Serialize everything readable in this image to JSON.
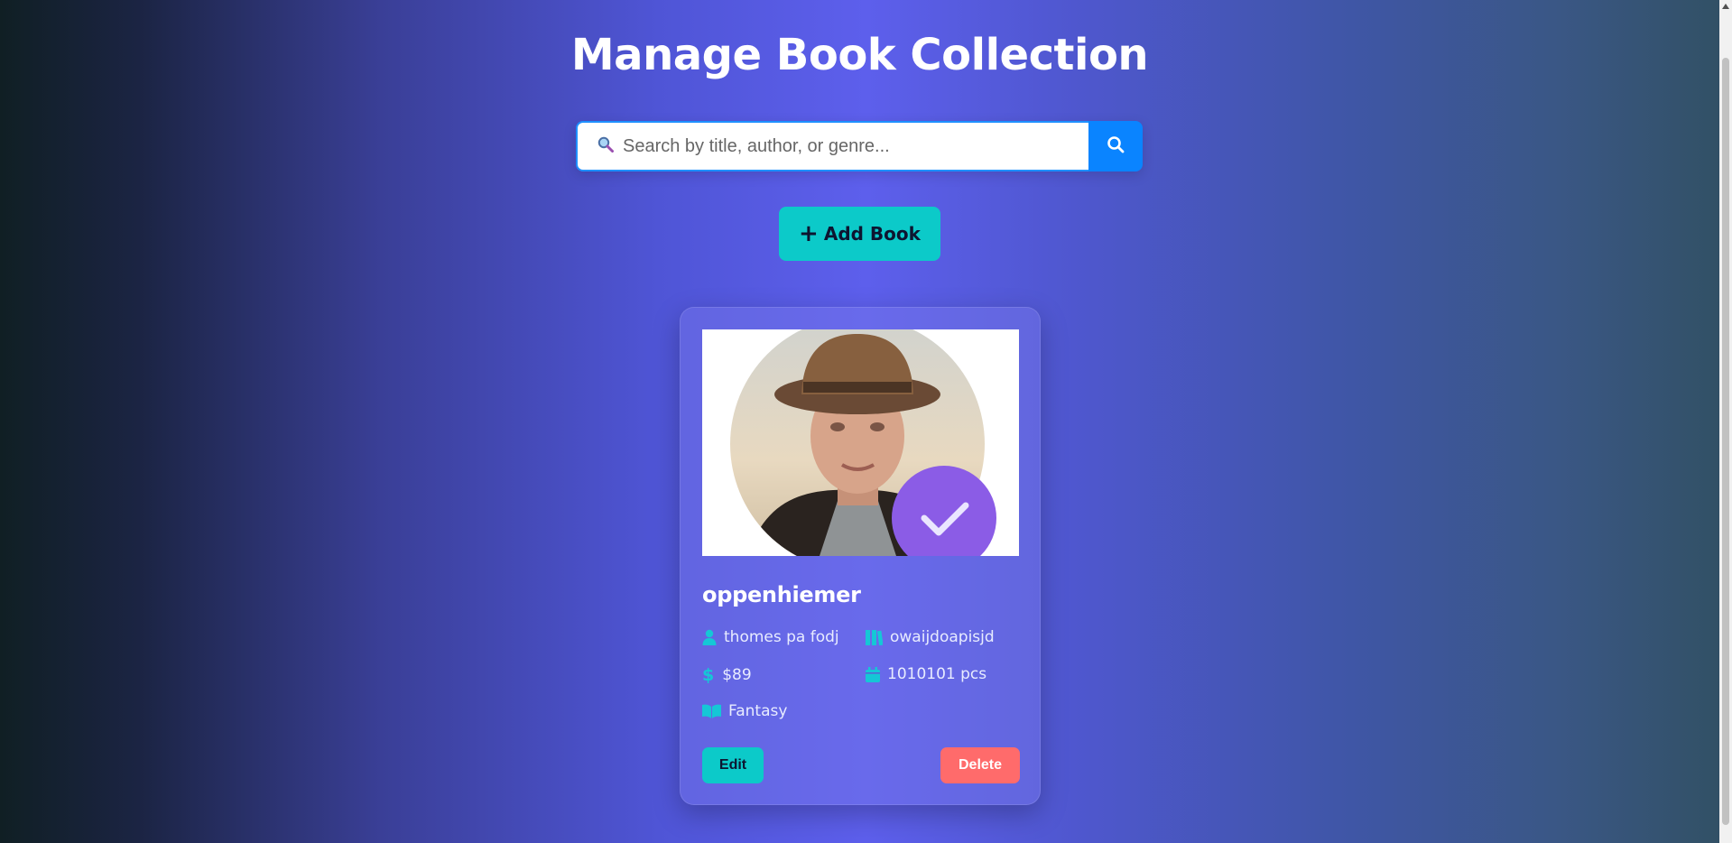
{
  "header": {
    "title": "Manage Book Collection"
  },
  "search": {
    "placeholder": "Search by title, author, or genre...",
    "value": "",
    "icon": "search-icon"
  },
  "actions": {
    "add_label": "Add Book"
  },
  "books": [
    {
      "title": "oppenhiemer",
      "author": "thomes pa fodj",
      "publisher": "owaijdoapisjd",
      "price": "$89",
      "stock": "1010101 pcs",
      "genre": "Fantasy",
      "edit_label": "Edit",
      "delete_label": "Delete"
    }
  ],
  "colors": {
    "accent": "#0ccac9",
    "danger": "#ff6b6b",
    "search_button": "#0a84ff",
    "badge": "#8b5ce6"
  }
}
